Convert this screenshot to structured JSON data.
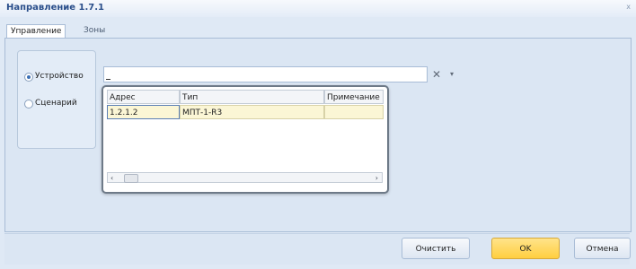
{
  "window": {
    "title": "Направление 1.7.1",
    "close_glyph": "x"
  },
  "tabs": [
    {
      "label": "Управление",
      "active": true
    },
    {
      "label": "Зоны",
      "active": false
    }
  ],
  "source_options": [
    {
      "label": "Устройство",
      "selected": true
    },
    {
      "label": "Сценарий",
      "selected": false
    }
  ],
  "device_combo": {
    "value": "",
    "clear_icon": "close-icon",
    "dropdown_icon": "chevron-down-icon"
  },
  "popup_grid": {
    "columns": [
      "Адрес",
      "Тип",
      "Примечание"
    ],
    "rows": [
      {
        "address": "1.2.1.2",
        "type": "МПТ-1-R3",
        "note": ""
      }
    ]
  },
  "buttons": {
    "clear": "Очистить",
    "ok": "OK",
    "cancel": "Отмена"
  },
  "colors": {
    "accent_ok": "#ffcf40",
    "selection_row": "#fbf6d5"
  }
}
